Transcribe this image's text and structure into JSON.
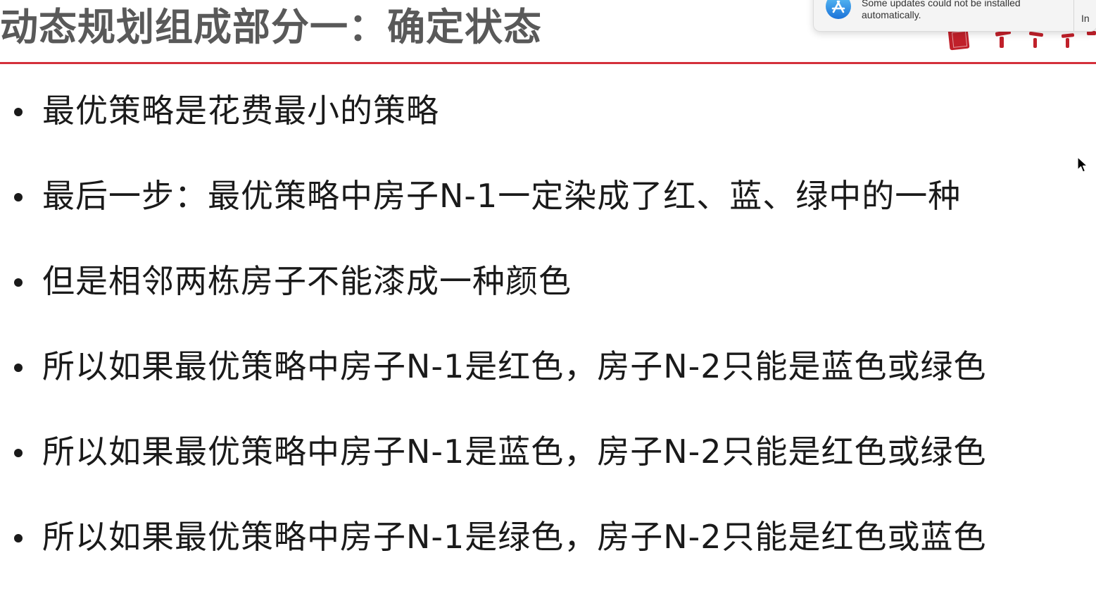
{
  "slide": {
    "title": "动态规划组成部分一：确定状态",
    "bullets": [
      "最优策略是花费最小的策略",
      "最后一步：最优策略中房子N-1一定染成了红、蓝、绿中的一种",
      "但是相邻两栋房子不能漆成一种颜色",
      "所以如果最优策略中房子N-1是红色，房子N-2只能是蓝色或绿色",
      "所以如果最优策略中房子N-1是蓝色，房子N-2只能是红色或绿色",
      "所以如果最优策略中房子N-1是绿色，房子N-2只能是红色或蓝色"
    ],
    "accent_color": "#d4303a",
    "title_color": "#595959",
    "text_color": "#1a1a1a"
  },
  "notification": {
    "icon": "app-store-icon",
    "message": "Some updates could not be installed automatically.",
    "action_label": "In"
  },
  "cursor": {
    "icon": "pointer-cursor-icon"
  }
}
